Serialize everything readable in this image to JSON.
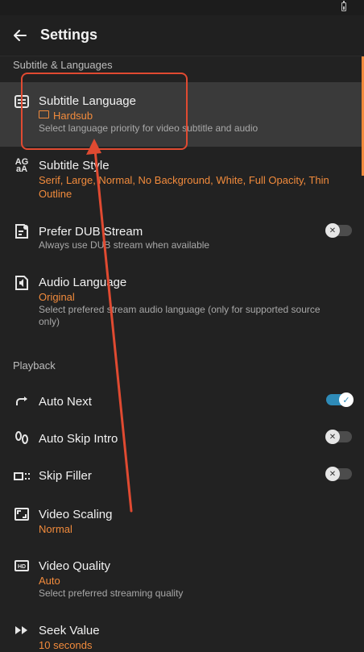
{
  "header": {
    "title": "Settings"
  },
  "sections": {
    "subtitle_languages": "Subtitle & Languages",
    "playback": "Playback"
  },
  "settings": {
    "subtitle_language": {
      "label": "Subtitle Language",
      "value": "Hardsub",
      "desc": "Select language priority for video subtitle and audio"
    },
    "subtitle_style": {
      "label": "Subtitle Style",
      "value": "Serif, Large, Normal, No Background, White, Full Opacity, Thin Outline"
    },
    "prefer_dub": {
      "label": "Prefer DUB Stream",
      "desc": "Always use DUB stream when available",
      "enabled": false
    },
    "audio_language": {
      "label": "Audio Language",
      "value": "Original",
      "desc": "Select prefered stream audio language (only for supported source only)"
    },
    "auto_next": {
      "label": "Auto Next",
      "enabled": true
    },
    "auto_skip_intro": {
      "label": "Auto Skip Intro",
      "enabled": false
    },
    "skip_filler": {
      "label": "Skip Filler",
      "enabled": false
    },
    "video_scaling": {
      "label": "Video Scaling",
      "value": "Normal"
    },
    "video_quality": {
      "label": "Video Quality",
      "value": "Auto",
      "desc": "Select preferred streaming quality"
    },
    "seek_value": {
      "label": "Seek Value",
      "value": "10 seconds"
    }
  },
  "colors": {
    "accent": "#f28b3c",
    "toggle_on": "#2e8bb8",
    "annotation": "#e04a31",
    "background": "#222222"
  },
  "icons": {
    "back": "arrow-left-icon",
    "subtitle_language": "subtitles-icon",
    "subtitle_style": "text-style-icon",
    "prefer_dub": "dub-icon",
    "audio_language": "audio-icon",
    "auto_next": "redo-icon",
    "auto_skip_intro": "footsteps-icon",
    "skip_filler": "skip-filler-icon",
    "video_scaling": "aspect-ratio-icon",
    "video_quality": "hd-icon",
    "seek_value": "fast-forward-icon"
  }
}
